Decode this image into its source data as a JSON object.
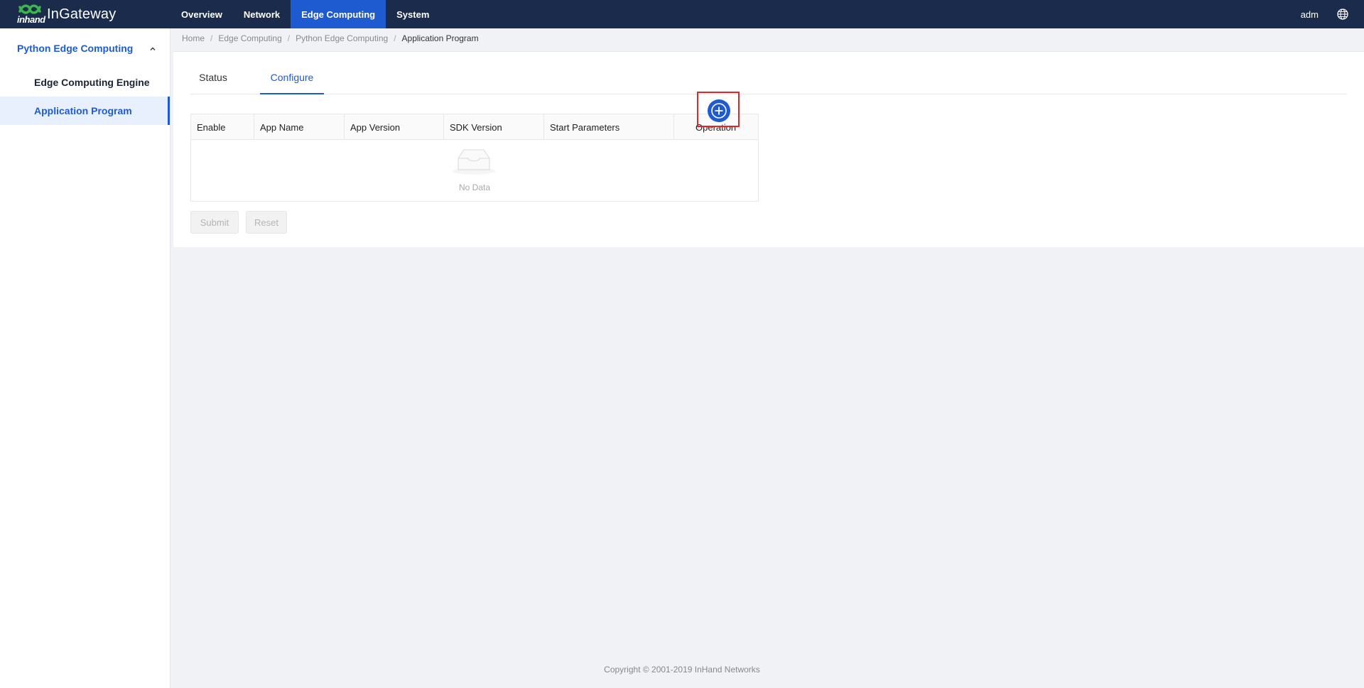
{
  "app": {
    "logo_small": "inhand",
    "logo_title": "InGateway",
    "user": "adm",
    "globe_icon": "globe-icon"
  },
  "nav": {
    "items": [
      {
        "label": "Overview"
      },
      {
        "label": "Network"
      },
      {
        "label": "Edge Computing"
      },
      {
        "label": "System"
      }
    ],
    "active": "Edge Computing"
  },
  "sidebar": {
    "group_label": "Python Edge Computing",
    "group_icon": "chevron-up-icon",
    "items": [
      {
        "label": "Edge Computing Engine"
      },
      {
        "label": "Application Program"
      }
    ],
    "active": "Application Program"
  },
  "breadcrumb": {
    "items": [
      "Home",
      "Edge Computing",
      "Python Edge Computing",
      "Application Program"
    ],
    "separator": "/"
  },
  "tabs": {
    "items": [
      {
        "label": "Status"
      },
      {
        "label": "Configure"
      }
    ],
    "active": "Configure"
  },
  "table": {
    "columns": [
      "Enable",
      "App Name",
      "App Version",
      "SDK Version",
      "Start Parameters",
      "Operation"
    ],
    "rows": [],
    "empty_text": "No Data",
    "empty_icon": "empty-inbox-icon"
  },
  "actions": {
    "submit_label": "Submit",
    "reset_label": "Reset",
    "add_icon": "plus-circle-icon"
  },
  "footer": {
    "copyright": "Copyright © 2001-2019 InHand Networks"
  },
  "colors": {
    "topbar": "#1a2b4c",
    "accent": "#1e5bd0",
    "highlight": "#e0262a"
  }
}
